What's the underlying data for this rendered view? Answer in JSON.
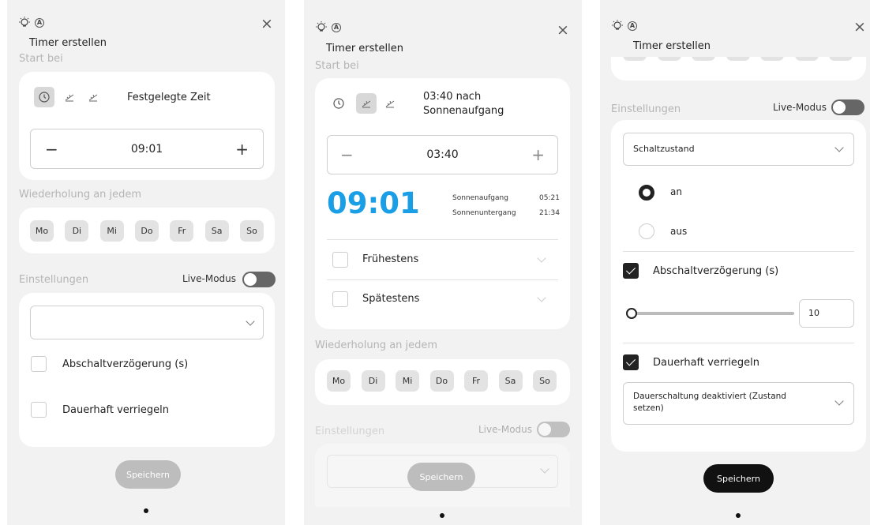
{
  "header": {
    "title": "Timer erstellen",
    "close": "×"
  },
  "sections": {
    "start": "Start bei",
    "repeat": "Wiederholung an jedem",
    "settings": "Einstellungen"
  },
  "live_mode": "Live-Modus",
  "days": [
    "Mo",
    "Di",
    "Mi",
    "Do",
    "Fr",
    "Sa",
    "So"
  ],
  "save": "Speichern",
  "panel1": {
    "mode_label": "Festgelegte Zeit",
    "stepper": {
      "minus": "−",
      "value": "09:01",
      "plus": "+"
    },
    "select_value": "",
    "checkboxes": [
      "Abschaltverzögerung (s)",
      "Dauerhaft verriegeln"
    ]
  },
  "panel2": {
    "mode_label": "03:40 nach Sonnenaufgang",
    "stepper": {
      "minus": "−",
      "value": "03:40",
      "plus": "+"
    },
    "big_time": "09:01",
    "sunrise_label": "Sonnenaufgang",
    "sunrise_time": "05:21",
    "sunset_label": "Sonnenuntergang",
    "sunset_time": "21:34",
    "earliest": "Frühestens",
    "latest": "Spätestens"
  },
  "panel3": {
    "select_value": "Schaltzustand",
    "radio_on": "an",
    "radio_off": "aus",
    "delay_label": "Abschaltverzögerung (s)",
    "slider_value": "10",
    "lock_label": "Dauerhaft verriegeln",
    "lock_select": "Dauerschaltung deaktiviert (Zustand setzen)"
  },
  "colors": {
    "accent_time": "#1a9fe6",
    "save_disabled": "#bdbdbd",
    "save_enabled": "#111111",
    "toggle_off": "#666666"
  }
}
